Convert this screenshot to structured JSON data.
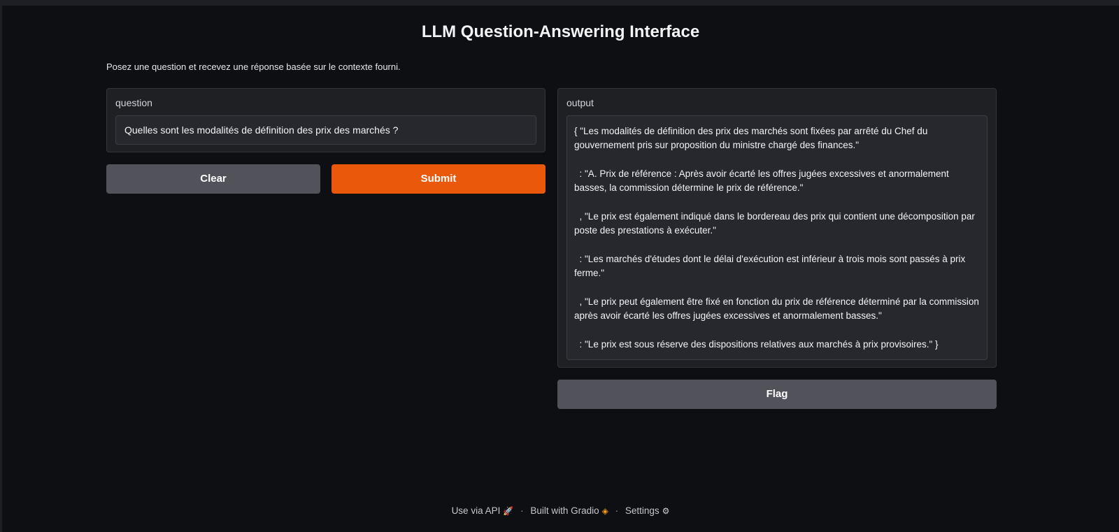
{
  "header": {
    "title": "LLM Question-Answering Interface",
    "description": "Posez une question et recevez une réponse basée sur le contexte fourni."
  },
  "question": {
    "label": "question",
    "value": "Quelles sont les modalités de définition des prix des marchés ?"
  },
  "buttons": {
    "clear": "Clear",
    "submit": "Submit",
    "flag": "Flag"
  },
  "output": {
    "label": "output",
    "paragraphs": [
      "{ \"Les modalités de définition des prix des marchés sont fixées par arrêté du Chef du gouvernement pris sur proposition du ministre chargé des finances.\"",
      "  : \"A. Prix de référence : Après avoir écarté les offres jugées excessives et anormalement basses, la commission détermine le prix de référence.\"",
      "  , \"Le prix est également indiqué dans le bordereau des prix qui contient une décomposition par poste des prestations à exécuter.\"",
      "  : \"Les marchés d'études dont le délai d'exécution est inférieur à trois mois sont passés à prix ferme.\"",
      "  , \"Le prix peut également être fixé en fonction du prix de référence déterminé par la commission après avoir écarté les offres jugées excessives et anormalement basses.\"",
      "  : \"Le prix est sous réserve des dispositions relatives aux marchés à prix provisoires.\" }"
    ]
  },
  "footer": {
    "api_link": "Use via API",
    "api_icon": "rocket-icon",
    "built_with": "Built with Gradio",
    "gradio_icon": "gradio-logo-icon",
    "settings": "Settings",
    "settings_icon": "gear-icon",
    "separator": "·"
  },
  "colors": {
    "accent": "#ea580c",
    "secondary_button": "#52535a",
    "background": "#0e0f12"
  }
}
